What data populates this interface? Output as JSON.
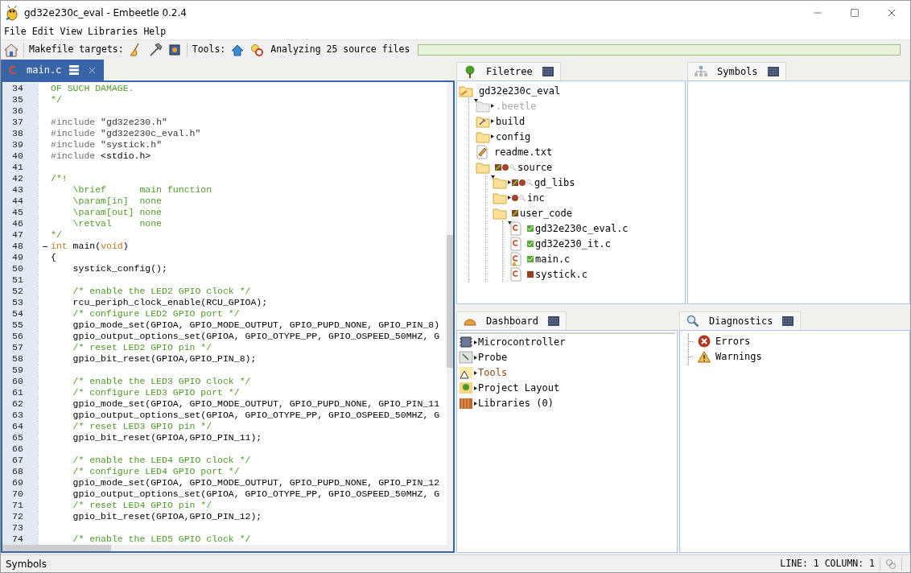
{
  "window": {
    "title": "gd32e230c_eval - Embeetle 0.2.4"
  },
  "menu": [
    "File",
    "Edit",
    "View",
    "Libraries",
    "Help"
  ],
  "toolbar": {
    "makefile_label": "Makefile targets:",
    "tools_label": "Tools:",
    "status": "Analyzing 25 source files",
    "progress": {
      "level": 1
    }
  },
  "editor": {
    "tab": {
      "label": "main.c",
      "selected": true
    },
    "lines": [
      {
        "number": "34",
        "fold": false,
        "segments": [
          {
            "kind": "comment",
            "text": "OF SUCH DAMAGE."
          }
        ]
      },
      {
        "number": "35",
        "fold": false,
        "segments": [
          {
            "kind": "comment",
            "text": "*/"
          }
        ]
      },
      {
        "number": "36",
        "fold": false
      },
      {
        "number": "37",
        "fold": false,
        "segments": [
          {
            "kind": "preprocessor",
            "text": "#include"
          },
          {
            "kind": "string",
            "text": " \"gd32e230.h\""
          }
        ]
      },
      {
        "number": "38",
        "fold": false,
        "segments": [
          {
            "kind": "preprocessor",
            "text": "#include"
          },
          {
            "kind": "string",
            "text": " \"gd32e230c_eval.h\""
          }
        ]
      },
      {
        "number": "39",
        "fold": false,
        "segments": [
          {
            "kind": "preprocessor",
            "text": "#include"
          },
          {
            "kind": "string",
            "text": " \"systick.h\""
          }
        ]
      },
      {
        "number": "40",
        "fold": false,
        "segments": [
          {
            "kind": "preprocessor",
            "text": "#include"
          },
          {
            "kind": "plain",
            "text": " <stdio.h>"
          }
        ]
      },
      {
        "number": "41",
        "fold": false
      },
      {
        "number": "42",
        "fold": false,
        "segments": [
          {
            "kind": "comment",
            "text": "/*!"
          }
        ]
      },
      {
        "number": "43",
        "fold": false,
        "segments": [
          {
            "kind": "comment",
            "text": "    \\brief      main function"
          }
        ]
      },
      {
        "number": "44",
        "fold": false,
        "segments": [
          {
            "kind": "comment",
            "text": "    \\param[in]  none"
          }
        ]
      },
      {
        "number": "45",
        "fold": false,
        "segments": [
          {
            "kind": "comment",
            "text": "    \\param[out] none"
          }
        ]
      },
      {
        "number": "46",
        "fold": false,
        "segments": [
          {
            "kind": "comment",
            "text": "    \\retval     none"
          }
        ]
      },
      {
        "number": "47",
        "fold": false,
        "segments": [
          {
            "kind": "comment",
            "text": "*/"
          }
        ]
      },
      {
        "number": "48",
        "fold": true,
        "segments": [
          {
            "kind": "keyword",
            "text": "int"
          },
          {
            "kind": "plain",
            "text": " main("
          },
          {
            "kind": "keyword",
            "text": "void"
          },
          {
            "kind": "plain",
            "text": ")"
          }
        ]
      },
      {
        "number": "49",
        "fold": false,
        "segments": [
          {
            "kind": "plain",
            "text": "{"
          }
        ]
      },
      {
        "number": "50",
        "fold": false,
        "segments": [
          {
            "kind": "plain",
            "text": "    systick_config();"
          }
        ]
      },
      {
        "number": "51",
        "fold": false
      },
      {
        "number": "52",
        "fold": false,
        "segments": [
          {
            "kind": "comment",
            "text": "    /* enable the LED2 GPIO clock */"
          }
        ]
      },
      {
        "number": "53",
        "fold": false,
        "segments": [
          {
            "kind": "plain",
            "text": "    rcu_periph_clock_enable(RCU_GPIOA);"
          }
        ]
      },
      {
        "number": "54",
        "fold": false,
        "segments": [
          {
            "kind": "comment",
            "text": "    /* configure LED2 GPIO port */"
          }
        ]
      },
      {
        "number": "55",
        "fold": false,
        "segments": [
          {
            "kind": "plain",
            "text": "    gpio_mode_set(GPIOA, GPIO_MODE_OUTPUT, GPIO_PUPD_NONE, GPIO_PIN_8)"
          }
        ]
      },
      {
        "number": "56",
        "fold": false,
        "segments": [
          {
            "kind": "plain",
            "text": "    gpio_output_options_set(GPIOA, GPIO_OTYPE_PP, GPIO_OSPEED_50MHZ, G"
          }
        ]
      },
      {
        "number": "57",
        "fold": false,
        "segments": [
          {
            "kind": "comment",
            "text": "    /* reset LED2 GPIO pin */"
          }
        ]
      },
      {
        "number": "58",
        "fold": false,
        "segments": [
          {
            "kind": "plain",
            "text": "    gpio_bit_reset(GPIOA,GPIO_PIN_8);"
          }
        ]
      },
      {
        "number": "59",
        "fold": false
      },
      {
        "number": "60",
        "fold": false,
        "segments": [
          {
            "kind": "comment",
            "text": "    /* enable the LED3 GPIO clock */"
          }
        ]
      },
      {
        "number": "61",
        "fold": false,
        "segments": [
          {
            "kind": "comment",
            "text": "    /* configure LED3 GPIO port */"
          }
        ]
      },
      {
        "number": "62",
        "fold": false,
        "segments": [
          {
            "kind": "plain",
            "text": "    gpio_mode_set(GPIOA, GPIO_MODE_OUTPUT, GPIO_PUPD_NONE, GPIO_PIN_11"
          }
        ]
      },
      {
        "number": "63",
        "fold": false,
        "segments": [
          {
            "kind": "plain",
            "text": "    gpio_output_options_set(GPIOA, GPIO_OTYPE_PP, GPIO_OSPEED_50MHZ, G"
          }
        ]
      },
      {
        "number": "64",
        "fold": false,
        "segments": [
          {
            "kind": "comment",
            "text": "    /* reset LED3 GPIO pin */"
          }
        ]
      },
      {
        "number": "65",
        "fold": false,
        "segments": [
          {
            "kind": "plain",
            "text": "    gpio_bit_reset(GPIOA,GPIO_PIN_11);"
          }
        ]
      },
      {
        "number": "66",
        "fold": false
      },
      {
        "number": "67",
        "fold": false,
        "segments": [
          {
            "kind": "comment",
            "text": "    /* enable the LED4 GPIO clock */"
          }
        ]
      },
      {
        "number": "68",
        "fold": false,
        "segments": [
          {
            "kind": "comment",
            "text": "    /* configure LED4 GPIO port */"
          }
        ]
      },
      {
        "number": "69",
        "fold": false,
        "segments": [
          {
            "kind": "plain",
            "text": "    gpio_mode_set(GPIOA, GPIO_MODE_OUTPUT, GPIO_PUPD_NONE, GPIO_PIN_12"
          }
        ]
      },
      {
        "number": "70",
        "fold": false,
        "segments": [
          {
            "kind": "plain",
            "text": "    gpio_output_options_set(GPIOA, GPIO_OTYPE_PP, GPIO_OSPEED_50MHZ, G"
          }
        ]
      },
      {
        "number": "71",
        "fold": false,
        "segments": [
          {
            "kind": "comment",
            "text": "    /* reset LED4 GPIO pin */"
          }
        ]
      },
      {
        "number": "72",
        "fold": false,
        "segments": [
          {
            "kind": "plain",
            "text": "    gpio_bit_reset(GPIOA,GPIO_PIN_12);"
          }
        ]
      },
      {
        "number": "73",
        "fold": false
      },
      {
        "number": "74",
        "fold": false,
        "segments": [
          {
            "kind": "comment",
            "text": "    /* enable the LED5 GPIO clock */"
          }
        ]
      }
    ]
  },
  "filetree": {
    "title": "Filetree",
    "root": {
      "label": "gd32e230c_eval",
      "kind": "root",
      "expanded": true,
      "dimmed": false,
      "build_mark": false,
      "error_dot": false,
      "lens": false,
      "children": [
        {
          "label": ".beetle",
          "kind": "folder-hidden",
          "expanded": false,
          "dimmed": true,
          "build_mark": false,
          "error_dot": false,
          "lens": false
        },
        {
          "label": "build",
          "kind": "folder-build",
          "expanded": false,
          "dimmed": false,
          "build_mark": false,
          "error_dot": false,
          "lens": false
        },
        {
          "label": "config",
          "kind": "folder",
          "expanded": false,
          "dimmed": false,
          "build_mark": false,
          "error_dot": false,
          "lens": false
        },
        {
          "label": "readme.txt",
          "kind": "file-text",
          "dimmed": false,
          "build_mark": false,
          "error_dot": false,
          "lens": false
        },
        {
          "label": "source",
          "kind": "folder",
          "expanded": true,
          "dimmed": false,
          "build_mark": true,
          "error_dot": true,
          "lens": true,
          "children": [
            {
              "label": "gd_libs",
              "kind": "folder",
              "expanded": false,
              "dimmed": false,
              "build_mark": true,
              "error_dot": true,
              "lens": true
            },
            {
              "label": "inc",
              "kind": "folder",
              "expanded": false,
              "dimmed": false,
              "build_mark": false,
              "error_dot": true,
              "lens": true
            },
            {
              "label": "user_code",
              "kind": "folder",
              "expanded": true,
              "dimmed": false,
              "build_mark": true,
              "error_dot": false,
              "lens": false,
              "children": [
                {
                  "label": "gd32e230c_eval.c",
                  "kind": "file-c",
                  "dimmed": false,
                  "passed": true
                },
                {
                  "label": "gd32e230_it.c",
                  "kind": "file-c",
                  "dimmed": false,
                  "passed": true
                },
                {
                  "label": "main.c",
                  "kind": "file-c-main",
                  "dimmed": false,
                  "passed": true
                },
                {
                  "label": "systick.c",
                  "kind": "file-c",
                  "dimmed": false,
                  "passed": false
                }
              ]
            }
          ]
        }
      ]
    }
  },
  "symbols": {
    "title": "Symbols"
  },
  "dashboard": {
    "title": "Dashboard",
    "items": [
      {
        "label": "Microcontroller",
        "kind": "chip",
        "warning": false
      },
      {
        "label": "Probe",
        "kind": "probe",
        "warning": false
      },
      {
        "label": "Tools",
        "kind": "tools",
        "warning": true
      },
      {
        "label": "Project Layout",
        "kind": "layout",
        "warning": false
      },
      {
        "label": "Libraries (0)",
        "kind": "libraries",
        "warning": false
      }
    ]
  },
  "diagnostics": {
    "title": "Diagnostics",
    "items": [
      {
        "label": "Errors",
        "kind": "error"
      },
      {
        "label": "Warnings",
        "kind": "warning"
      }
    ]
  },
  "status_bar": {
    "left": "Symbols",
    "position": "LINE: 1 COLUMN: 1"
  }
}
